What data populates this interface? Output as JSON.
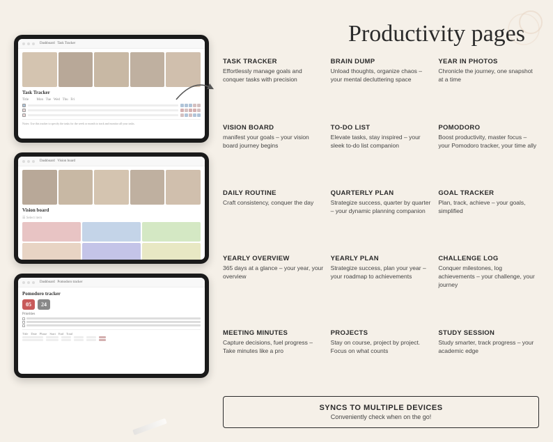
{
  "page": {
    "title": "Productivity pages",
    "background_color": "#f5f0e8"
  },
  "devices": [
    {
      "id": "device-1",
      "name": "Task Tracker",
      "label": "Task Tracker"
    },
    {
      "id": "device-2",
      "name": "Vision Board",
      "label": "Vision board"
    },
    {
      "id": "device-3",
      "name": "Pomodoro Tracker",
      "label": "Pomodoro tracker"
    }
  ],
  "features": [
    {
      "id": "task-tracker",
      "title": "TASK TRACKER",
      "desc": "Effortlessly manage goals and conquer tasks with precision"
    },
    {
      "id": "brain-dump",
      "title": "BRAIN DUMP",
      "desc": "Unload thoughts, organize chaos – your mental decluttering space"
    },
    {
      "id": "year-in-photos",
      "title": "YEAR IN PHOTOS",
      "desc": "Chronicle the journey, one snapshot at a time"
    },
    {
      "id": "vision-board",
      "title": "VISION BOARD",
      "desc": "manifest your goals – your vision board journey begins"
    },
    {
      "id": "to-do-list",
      "title": "TO-DO LIST",
      "desc": "Elevate tasks, stay inspired – your sleek to-do list companion"
    },
    {
      "id": "pomodoro",
      "title": "POMODORO",
      "desc": "Boost productivity, master focus – your Pomodoro tracker, your time ally"
    },
    {
      "id": "daily-routine",
      "title": "DAILY ROUTINE",
      "desc": "Craft consistency, conquer the day"
    },
    {
      "id": "quarterly-plan",
      "title": "QUARTERLY PLAN",
      "desc": "Strategize success, quarter by quarter – your dynamic planning companion"
    },
    {
      "id": "goal-tracker",
      "title": "GOAL TRACKER",
      "desc": "Plan, track, achieve – your goals, simplified"
    },
    {
      "id": "yearly-overview",
      "title": "YEARLY OVERVIEW",
      "desc": "365 days at a glance – your year, your overview"
    },
    {
      "id": "yearly-plan",
      "title": "YEARLY PLAN",
      "desc": "Strategize success, plan your year – your roadmap to achievements"
    },
    {
      "id": "challenge-log",
      "title": "CHALLENGE LOG",
      "desc": "Conquer milestones, log achievements – your challenge, your journey"
    },
    {
      "id": "meeting-minutes",
      "title": "MEETING MINUTES",
      "desc": "Capture decisions, fuel progress – Take minutes like a pro"
    },
    {
      "id": "projects",
      "title": "PROJECTS",
      "desc": "Stay on course, project by project. Focus on what counts"
    },
    {
      "id": "study-session",
      "title": "STUDY SESSION",
      "desc": "Study smarter, track progress – your academic edge"
    }
  ],
  "syncs": {
    "title": "SYNCS TO MULTIPLE DEVICES",
    "desc": "Conveniently check when on the go!"
  },
  "timer": {
    "minutes": "05",
    "seconds": "24"
  }
}
